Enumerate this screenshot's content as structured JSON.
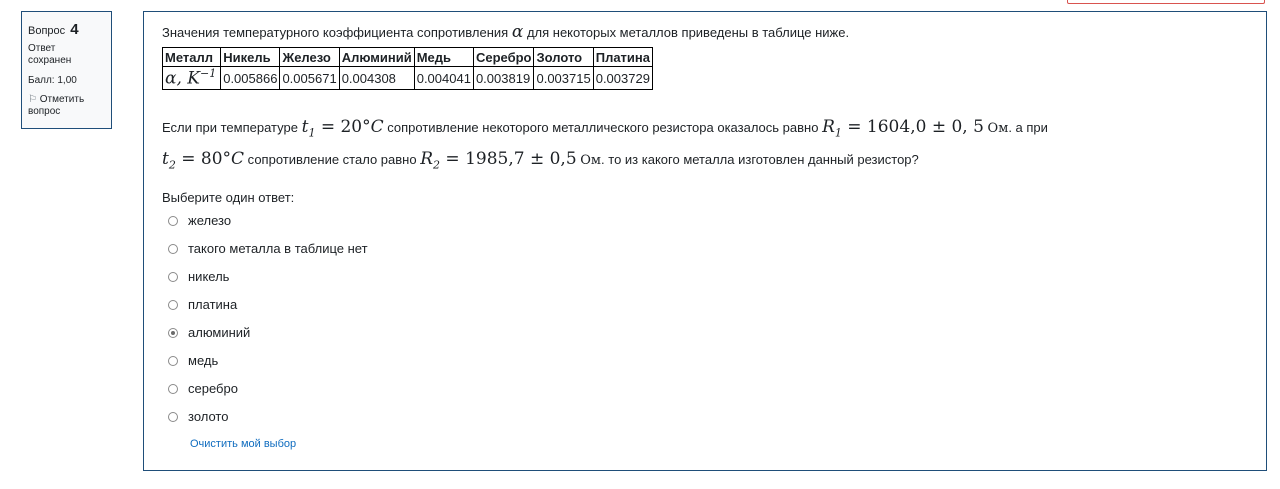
{
  "info": {
    "question_label": "Вопрос",
    "question_number": "4",
    "state_line1": "Ответ",
    "state_line2": "сохранен",
    "grade": "Балл: 1,00",
    "flag_line1": "Отметить",
    "flag_line2": "вопрос"
  },
  "question": {
    "intro_before": "Значения температурного коэффициента сопротивления",
    "alpha_symbol": "α",
    "intro_after": "для некоторых металлов приведены в таблице ниже.",
    "table": {
      "headers": [
        "Металл",
        "Никель",
        "Железо",
        "Алюминий",
        "Медь",
        "Серебро",
        "Золото",
        "Платина"
      ],
      "row_label": "α, K",
      "row_label_exp": "−1",
      "values": [
        "0.005866",
        "0.005671",
        "0.004308",
        "0.004041",
        "0.003819",
        "0.003715",
        "0.003729"
      ]
    },
    "p1": "Если при температуре",
    "t1_var": "t",
    "t1_sub": "1",
    "t1_val": " = 20°",
    "t1_unit": "C",
    "p2": "сопротивление некоторого металлического резистора оказалось равно",
    "r1_var": "R",
    "r1_sub": "1",
    "r1_val": " = 1604,0 ± 0, 5",
    "unit_ohm": "Ом",
    "p3": ". а при",
    "t2_var": "t",
    "t2_sub": "2",
    "t2_val": " = 80°",
    "t2_unit": "C",
    "p4": "сопротивление стало равно",
    "r2_var": "R",
    "r2_sub": "2",
    "r2_val": " = 1985,7 ± 0,5",
    "p5": ". то из какого металла изготовлен данный резистор?"
  },
  "answer": {
    "prompt": "Выберите один ответ:",
    "options": [
      {
        "label": "железо",
        "selected": false
      },
      {
        "label": "такого металла в таблице нет",
        "selected": false
      },
      {
        "label": "никель",
        "selected": false
      },
      {
        "label": "платина",
        "selected": false
      },
      {
        "label": "алюминий",
        "selected": true
      },
      {
        "label": "медь",
        "selected": false
      },
      {
        "label": "серебро",
        "selected": false
      },
      {
        "label": "золото",
        "selected": false
      }
    ],
    "clear_label": "Очистить мой выбор"
  },
  "colors": {
    "border": "#1f4e79",
    "link": "#0f6cbf",
    "alert_border": "#d9534f"
  },
  "icons": {
    "flag": "flag-icon",
    "radio": "radio-icon"
  }
}
